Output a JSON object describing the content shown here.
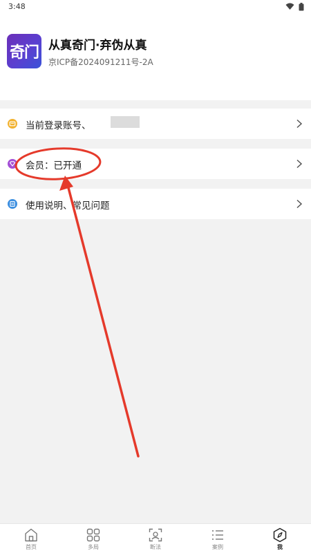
{
  "status_bar": {
    "time": "3:48"
  },
  "app": {
    "logo_text": "奇门",
    "title": "从真奇门·弃伪从真",
    "icp": "京ICP备2024091211号-2A"
  },
  "menu": [
    {
      "label": "当前登录账号、",
      "icon": "account-card-icon"
    },
    {
      "label": "会员：已开通",
      "icon": "vip-diamond-icon"
    },
    {
      "label": "使用说明、常见问题",
      "icon": "manual-doc-icon"
    }
  ],
  "tabs": [
    {
      "label": "首页",
      "icon": "home-icon",
      "active": false
    },
    {
      "label": "多局",
      "icon": "grid-icon",
      "active": false
    },
    {
      "label": "断法",
      "icon": "scan-icon",
      "active": false
    },
    {
      "label": "案例",
      "icon": "list-icon",
      "active": false
    },
    {
      "label": "我",
      "icon": "compass-icon",
      "active": true
    }
  ],
  "colors": {
    "accent_red": "#e53a2b",
    "logo_gradient_start": "#6b2fb8",
    "logo_gradient_end": "#3a52d8",
    "background": "#f2f2f2"
  }
}
